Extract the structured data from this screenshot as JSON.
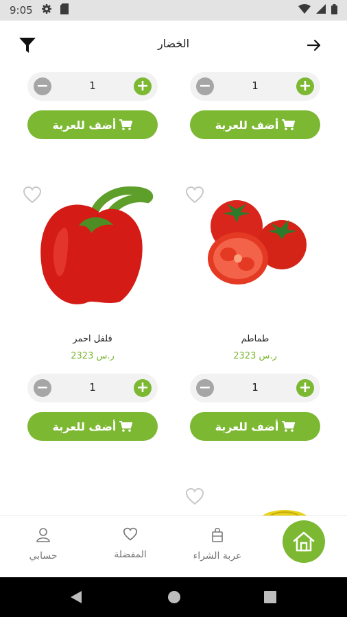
{
  "status_bar": {
    "time": "9:05"
  },
  "app_bar": {
    "title": "الخضار"
  },
  "top_row": {
    "left": {
      "quantity": "1",
      "add_label": "أضف للعربة"
    },
    "right": {
      "quantity": "1",
      "add_label": "أضف للعربة"
    }
  },
  "products": [
    {
      "name": "طماطم",
      "price": "2323 ر.س",
      "quantity": "1",
      "add_label": "أضف للعربة"
    },
    {
      "name": "فلفل احمر",
      "price": "2323 ر.س",
      "quantity": "1",
      "add_label": "أضف للعربة"
    }
  ],
  "bottom_nav": {
    "cart": "عربة الشراء",
    "favorites": "المفضلة",
    "account": "حسابي"
  },
  "colors": {
    "accent": "#7cb832",
    "muted": "#a6a6a6",
    "status_bar": "#e3e3e3"
  }
}
